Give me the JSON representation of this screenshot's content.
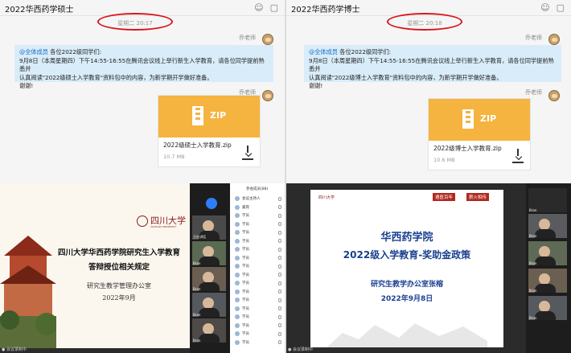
{
  "left_chat": {
    "title": "2022华西药学硕士",
    "datestamp": "星期二 20:17",
    "sender": "乔老师",
    "sender2": "乔老师",
    "mention": "@全体成员",
    "message": [
      "各位2022级同学们:",
      "9月8日（本周星期四）下午14:55-16:55在腾讯会议线上举行新生入学教育，请各位同学提前熟悉并",
      "认真阅读\"2022级硕士入学教育\"资料包中的内容，为新学期开学做好准备。",
      "谢谢!"
    ],
    "file_type": "ZIP",
    "file_name": "2022级硕士入学教育.zip",
    "file_size": "10.7 MB"
  },
  "right_chat": {
    "title": "2022华西药学博士",
    "datestamp": "星期二 20:18",
    "sender": "乔老师",
    "sender2": "乔老师",
    "mention": "@全体成员",
    "message": [
      "各位2022级同学们:",
      "9月8日（本周星期四）下午14:55-16:55在腾讯会议线上举行新生入学教育，请各位同学提前熟悉并",
      "认真阅读\"2022级博士入学教育\"资料包中的内容，为新学期开学做好准备。",
      "谢谢!"
    ],
    "file_type": "ZIP",
    "file_name": "2022级博士入学教育.zip",
    "file_size": "10.6 MB"
  },
  "left_slide": {
    "logo_text": "四川大学",
    "logo_sub": "SICHUAN UNIVERSITY",
    "title1": "四川大学华西药学院研究生入学教育",
    "title2": "答辩授位相关规定",
    "office": "研究生教学管理办公室",
    "date": "2022年9月"
  },
  "right_slide": {
    "logo_text": "四川大学",
    "tag1": "遵医百年",
    "tag2": "薪火相传",
    "title1": "华西药学院",
    "title2": "2022级入学教育-奖助金政策",
    "presenter": "研究生教学办公室张榕",
    "date": "2022年9月8日"
  },
  "left_meeting": {
    "status": "● 会议录制中",
    "video_labels": [
      "正在讲话",
      "Bran",
      "Bran",
      "Bran",
      "Bran"
    ],
    "participant_header": "参会成员(88)",
    "participants": [
      "会议主持人",
      "嘉宾",
      "学员",
      "学员",
      "学员",
      "学员",
      "学员",
      "学员",
      "学员",
      "学员",
      "学员",
      "学员",
      "学员",
      "学员",
      "学员",
      "学员",
      "学员",
      "学员"
    ]
  },
  "right_meeting": {
    "status": "● 会议录制中",
    "video_labels": [
      "Bran",
      "Bran",
      "Bran",
      "Bran",
      "Bran"
    ]
  },
  "colors": {
    "accent_blue": "#2d7ff9",
    "zip_orange": "#f5b340",
    "highlight_red": "#d8141b",
    "bubble_blue": "#d9ecf9"
  }
}
